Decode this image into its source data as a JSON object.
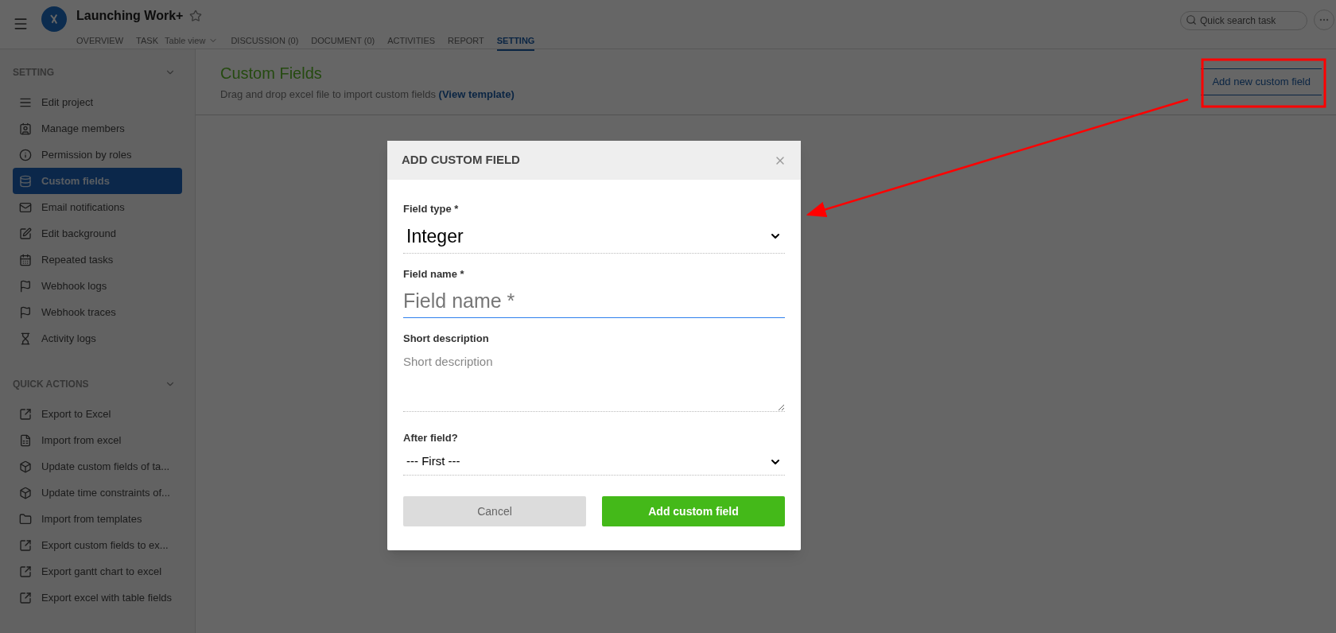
{
  "header": {
    "project_title": "Launching Work+",
    "starred": false,
    "tabs": [
      {
        "label": "OVERVIEW",
        "selected": false
      },
      {
        "label": "TASK",
        "selected": false,
        "view": "Table view"
      },
      {
        "label": "DISCUSSION (0)",
        "selected": false
      },
      {
        "label": "DOCUMENT (0)",
        "selected": false
      },
      {
        "label": "ACTIVITIES",
        "selected": false
      },
      {
        "label": "REPORT",
        "selected": false
      },
      {
        "label": "SETTING",
        "selected": true
      }
    ],
    "search": {
      "placeholder": "Quick search task"
    }
  },
  "sidebar": {
    "sections": [
      {
        "title": "SETTING",
        "expanded": true,
        "items": [
          {
            "label": "Edit project",
            "selected": false
          },
          {
            "label": "Manage members",
            "selected": false
          },
          {
            "label": "Permission by roles",
            "selected": false
          },
          {
            "label": "Custom fields",
            "selected": true
          },
          {
            "label": "Email notifications",
            "selected": false
          },
          {
            "label": "Edit background",
            "selected": false
          },
          {
            "label": "Repeated tasks",
            "selected": false
          },
          {
            "label": "Webhook logs",
            "selected": false
          },
          {
            "label": "Webhook traces",
            "selected": false
          },
          {
            "label": "Activity logs",
            "selected": false
          }
        ]
      },
      {
        "title": "QUICK ACTIONS",
        "expanded": true,
        "items": [
          {
            "label": "Export to Excel",
            "selected": false
          },
          {
            "label": "Import from excel",
            "selected": false
          },
          {
            "label": "Update custom fields of ta...",
            "selected": false
          },
          {
            "label": "Update time constraints of...",
            "selected": false
          },
          {
            "label": "Import from templates",
            "selected": false
          },
          {
            "label": "Export custom fields to ex...",
            "selected": false
          },
          {
            "label": "Export gantt chart to excel",
            "selected": false
          },
          {
            "label": "Export excel with table fields",
            "selected": false
          }
        ]
      }
    ]
  },
  "content": {
    "title": "Custom Fields",
    "subtitle": "Drag and drop excel file to import custom fields",
    "subtitle_link": "(View template)",
    "action_button": "Add new custom field"
  },
  "modal": {
    "title": "ADD CUSTOM FIELD",
    "fields": [
      {
        "kind": "select",
        "label": "Field type *",
        "value": "Integer"
      },
      {
        "kind": "input",
        "label": "Field name *",
        "placeholder": "Field name *",
        "focused": true
      },
      {
        "kind": "textarea",
        "label": "Short description",
        "placeholder": "Short description"
      },
      {
        "kind": "select-small",
        "label": "After field?",
        "value": "--- First ---"
      }
    ],
    "buttons": [
      {
        "kind": "secondary",
        "label": "Cancel"
      },
      {
        "kind": "primary",
        "label": "Add custom field"
      }
    ]
  }
}
